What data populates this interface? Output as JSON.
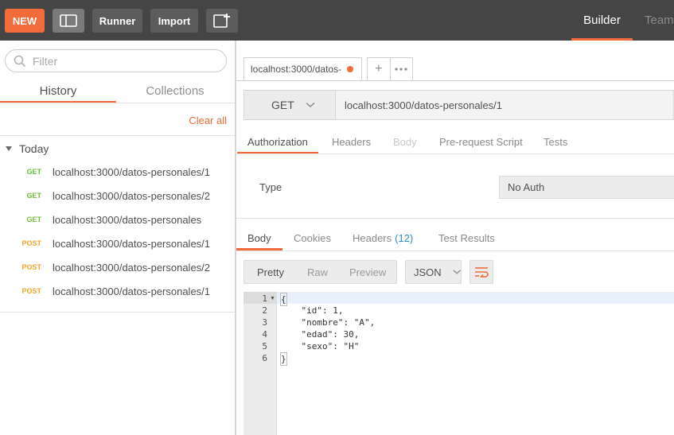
{
  "toolbar": {
    "new_label": "NEW",
    "runner_label": "Runner",
    "import_label": "Import",
    "builder_tab": "Builder",
    "team_tab": "Team"
  },
  "sidebar": {
    "filter_placeholder": "Filter",
    "tabs": {
      "history": "History",
      "collections": "Collections"
    },
    "clear_all": "Clear all",
    "group": "Today",
    "history": [
      {
        "method": "GET",
        "url": "localhost:3000/datos-personales/1"
      },
      {
        "method": "GET",
        "url": "localhost:3000/datos-personales/2"
      },
      {
        "method": "GET",
        "url": "localhost:3000/datos-personales"
      },
      {
        "method": "POST",
        "url": "localhost:3000/datos-personales/1"
      },
      {
        "method": "POST",
        "url": "localhost:3000/datos-personales/2"
      },
      {
        "method": "POST",
        "url": "localhost:3000/datos-personales/1"
      }
    ]
  },
  "request": {
    "tab_title": "localhost:3000/datos-",
    "method": "GET",
    "url": "localhost:3000/datos-personales/1",
    "subtabs": [
      "Authorization",
      "Headers",
      "Body",
      "Pre-request Script",
      "Tests"
    ],
    "auth": {
      "type_label": "Type",
      "type_value": "No Auth"
    }
  },
  "response": {
    "tabs": {
      "body": "Body",
      "cookies": "Cookies",
      "headers": "Headers",
      "headers_count": "(12)",
      "tests": "Test Results"
    },
    "views": [
      "Pretty",
      "Raw",
      "Preview"
    ],
    "format": "JSON",
    "body_lines": [
      "{",
      "    \"id\": 1,",
      "    \"nombre\": \"A\",",
      "    \"edad\": 30,",
      "    \"sexo\": \"H\"",
      "}"
    ],
    "line_numbers": [
      "1",
      "2",
      "3",
      "4",
      "5",
      "6"
    ]
  },
  "colors": {
    "accent": "#f26b3a",
    "get": "#6fbf3f",
    "post": "#f4a62a",
    "topbar": "#454545"
  }
}
